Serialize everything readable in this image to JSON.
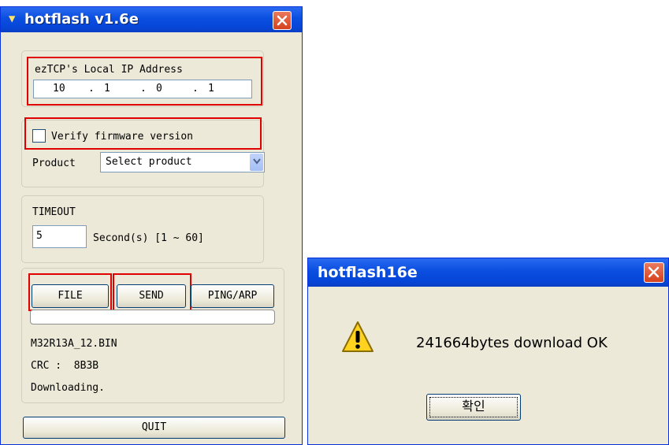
{
  "main_window": {
    "title": "hotflash v1.6e",
    "ip_group_label": "ezTCP's Local IP Address",
    "ip_octets": [
      "10",
      "1",
      "0",
      "1"
    ],
    "verify_label": "Verify firmware version",
    "verify_checked": false,
    "product_label": "Product",
    "product_selected": "Select product",
    "timeout_label": "TIMEOUT",
    "timeout_value": "5",
    "timeout_unit": "Second(s) [1 ~ 60]",
    "file_button": "FILE",
    "send_button": "SEND",
    "ping_button": "PING/ARP",
    "progress_fraction": 0.0,
    "file_name": "M32R13A_12.BIN",
    "crc_text": "CRC :  8B3B",
    "status_text": "Downloading.",
    "quit_button": "QUIT"
  },
  "dialog": {
    "title": "hotflash16e",
    "message": "241664bytes download OK",
    "ok_button": "확인",
    "icon": "warning-icon"
  },
  "colors": {
    "titlebar": "#0a4ee0",
    "highlight": "#e10000",
    "close_button": "#d6411d",
    "window_bg": "#ece9d8"
  }
}
